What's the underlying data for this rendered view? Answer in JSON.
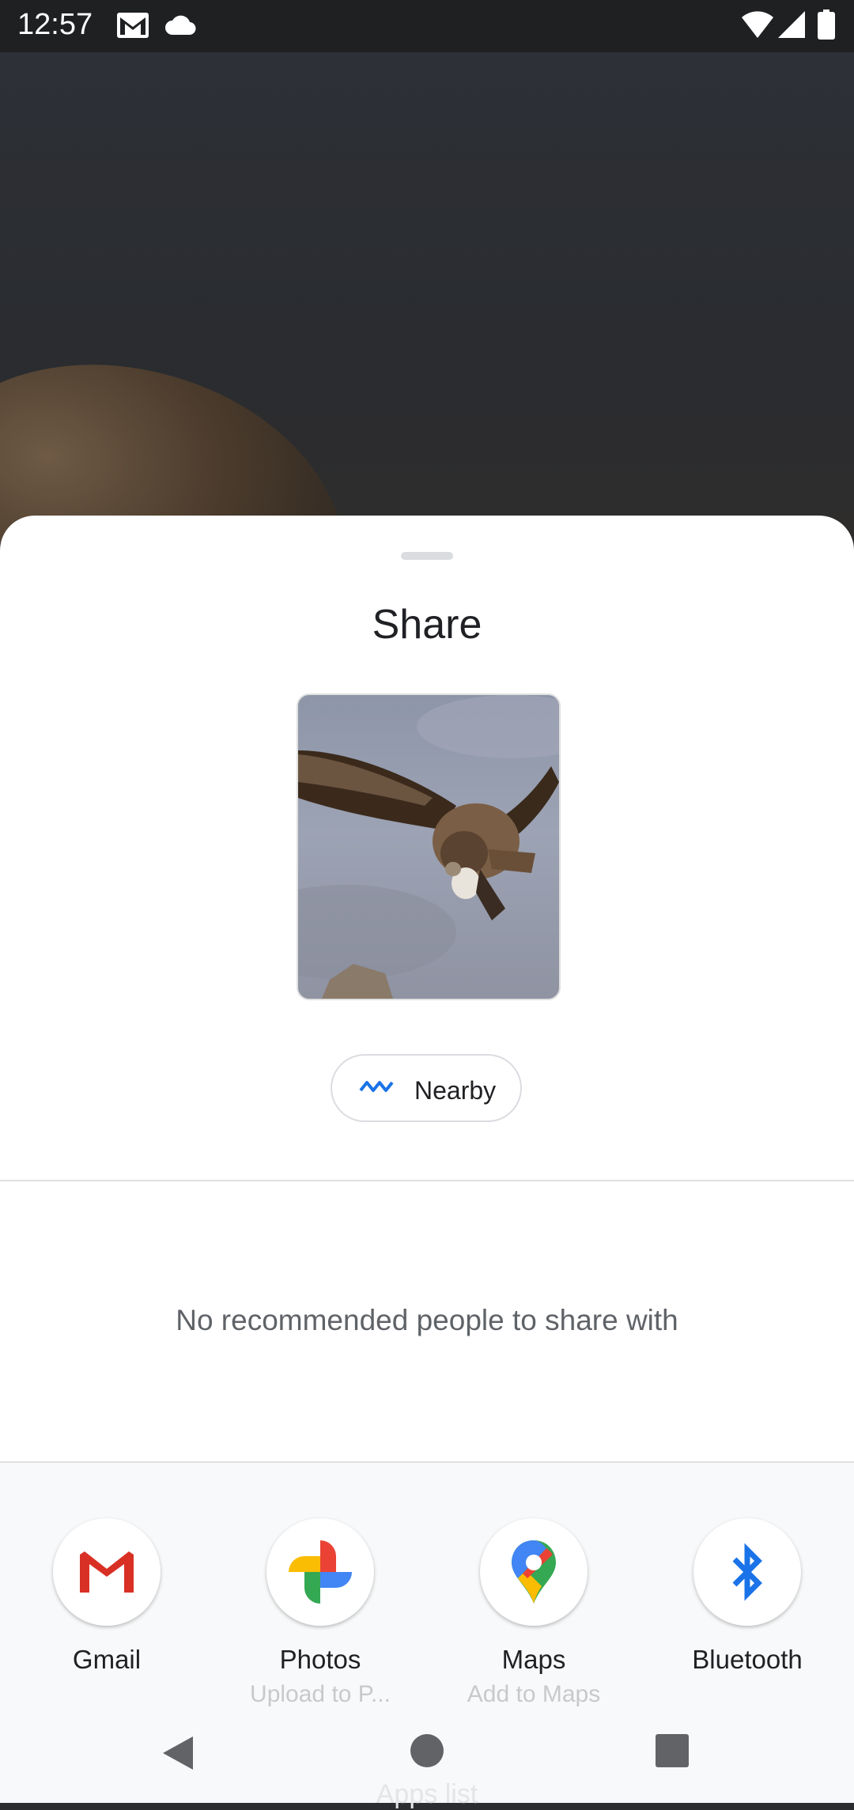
{
  "status_bar": {
    "time": "12:57",
    "icons": [
      "gmail-notification-icon",
      "cloud-icon",
      "wifi-icon",
      "cell-signal-icon",
      "battery-icon"
    ]
  },
  "share_sheet": {
    "title": "Share",
    "nearby_label": "Nearby",
    "no_recommendations": "No recommended people to share with",
    "apps": [
      {
        "label": "Gmail",
        "sub": ""
      },
      {
        "label": "Photos",
        "sub": "Upload to P..."
      },
      {
        "label": "Maps",
        "sub": "Add to Maps"
      },
      {
        "label": "Bluetooth",
        "sub": ""
      }
    ],
    "apps_list_label": "Apps list"
  },
  "colors": {
    "accent_blue": "#1a73e8",
    "gmail_red": "#d93025"
  },
  "nav_bar": {
    "buttons": [
      "back-icon",
      "home-icon",
      "recents-icon"
    ]
  }
}
